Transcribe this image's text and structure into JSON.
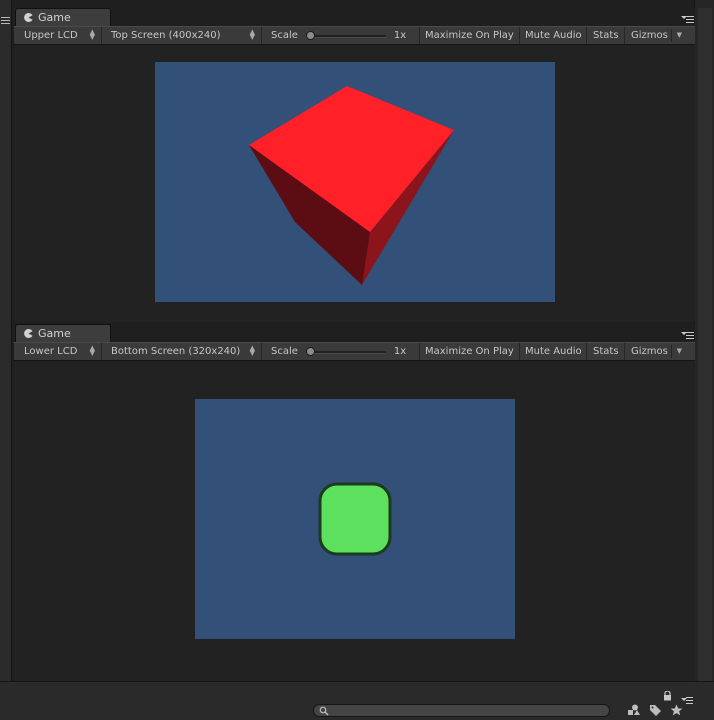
{
  "panels": [
    {
      "tab_label": "Game",
      "target_label": "Upper LCD",
      "resolution_label": "Top Screen (400x240)",
      "scale_label": "Scale",
      "scale_slider_value": 0,
      "zoom_label": "1x",
      "maximize_label": "Maximize On Play",
      "mute_label": "Mute Audio",
      "stats_label": "Stats",
      "gizmos_label": "Gizmos",
      "game_background": "#325078",
      "object_color": "#ff2028"
    },
    {
      "tab_label": "Game",
      "target_label": "Lower LCD",
      "resolution_label": "Bottom Screen (320x240)",
      "scale_label": "Scale",
      "scale_slider_value": 0,
      "zoom_label": "1x",
      "maximize_label": "Maximize On Play",
      "mute_label": "Mute Audio",
      "stats_label": "Stats",
      "gizmos_label": "Gizmos",
      "game_background": "#325078",
      "object_color": "#5ce05e"
    }
  ],
  "status_bar": {
    "icons": [
      "lock-icon",
      "menu-icon",
      "search-icon",
      "shapes-icon",
      "tag-icon",
      "star-icon"
    ]
  }
}
